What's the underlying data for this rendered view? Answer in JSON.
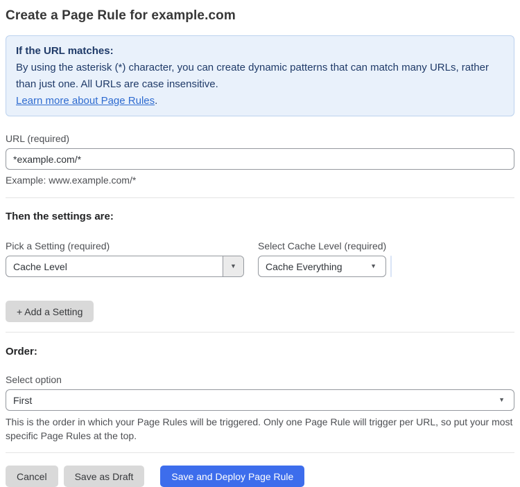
{
  "page": {
    "title": "Create a Page Rule for example.com"
  },
  "info_box": {
    "heading": "If the URL matches:",
    "body": "By using the asterisk (*) character, you can create dynamic patterns that can match many URLs, rather than just one. All URLs are case insensitive.",
    "link_label": "Learn more about Page Rules",
    "link_suffix": "."
  },
  "url_field": {
    "label": "URL (required)",
    "value": "*example.com/*",
    "helper": "Example: www.example.com/*"
  },
  "settings_section": {
    "heading": "Then the settings are:",
    "setting_picker": {
      "label": "Pick a Setting (required)",
      "value": "Cache Level"
    },
    "cache_level_picker": {
      "label": "Select Cache Level (required)",
      "value": "Cache Everything"
    },
    "add_setting_button": "+ Add a Setting"
  },
  "order_section": {
    "heading": "Order:",
    "select_label": "Select option",
    "selected_option": "First",
    "helper": "This is the order in which your Page Rules will be triggered. Only one Page Rule will trigger per URL, so put your most specific Page Rules at the top."
  },
  "footer": {
    "cancel_label": "Cancel",
    "save_draft_label": "Save as Draft",
    "save_deploy_label": "Save and Deploy Page Rule"
  },
  "icons": {
    "dropdown_arrow": "▼"
  },
  "colors": {
    "accent_blue": "#3d6dec",
    "info_bg": "#e9f1fb",
    "info_border": "#bcd2ee",
    "info_text": "#1f3a68",
    "link_blue": "#2e6bd0",
    "gray_button": "#d9d9d9"
  }
}
